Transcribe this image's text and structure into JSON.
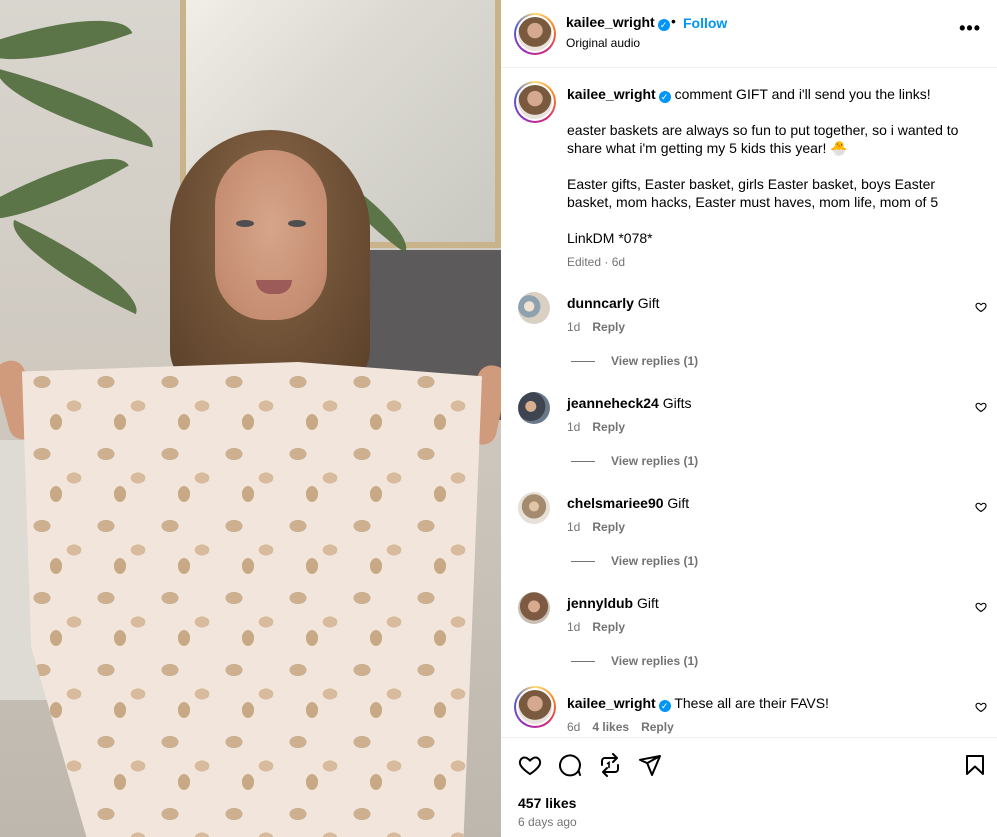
{
  "post": {
    "username": "kailee_wright",
    "follow_label": "Follow",
    "audio": "Original audio",
    "caption_lead": "comment GIFT and i'll send you the links!",
    "caption_p1": "easter baskets are always so fun to put together, so i wanted to share what i'm getting my 5 kids this year! 🐣",
    "caption_p2": "Easter gifts, Easter basket, girls Easter basket, boys Easter basket, mom hacks, Easter must haves, mom life, mom of 5",
    "caption_p3": "LinkDM *078*",
    "caption_meta": "Edited · 6d",
    "likes": "457 likes",
    "time_ago": "6 days ago"
  },
  "comments": [
    {
      "user": "dunncarly",
      "text": "Gift",
      "age": "1d",
      "reply": "Reply",
      "view_replies": "View replies (1)"
    },
    {
      "user": "jeanneheck24",
      "text": "Gifts",
      "age": "1d",
      "reply": "Reply",
      "view_replies": "View replies (1)"
    },
    {
      "user": "chelsmariee90",
      "text": "Gift",
      "age": "1d",
      "reply": "Reply",
      "view_replies": "View replies (1)"
    },
    {
      "user": "jennyldub",
      "text": "Gift",
      "age": "1d",
      "reply": "Reply",
      "view_replies": "View replies (1)"
    }
  ],
  "author_comment": {
    "user": "kailee_wright",
    "text": "These all are their FAVS!",
    "age": "6d",
    "likes": "4 likes",
    "reply": "Reply"
  },
  "icons": [
    "more-icon",
    "heart-icon",
    "comment-icon",
    "share-icon",
    "send-icon",
    "bookmark-icon",
    "verified-icon"
  ],
  "colors": {
    "accent": "#0095f6",
    "muted": "#737373",
    "border": "#efefef"
  }
}
